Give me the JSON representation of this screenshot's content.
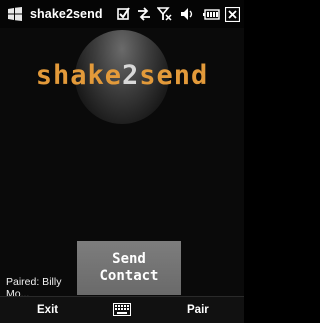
{
  "titlebar": {
    "title": "shake2send",
    "icons": [
      "windows-start-icon",
      "tasks-check-icon",
      "data-sync-icon",
      "no-signal-icon",
      "volume-icon",
      "battery-icon",
      "close-icon"
    ]
  },
  "logo": {
    "part1": "shake",
    "part2": "2",
    "part3": "send"
  },
  "paired": {
    "label": "Paired: Billy Mo..."
  },
  "send_button": {
    "line1": "Send",
    "line2": "Contact"
  },
  "softkeys": {
    "left": "Exit",
    "right": "Pair",
    "center_icon": "keyboard-icon"
  },
  "colors": {
    "logo_orange": "#e39a3a",
    "logo_gray": "#d9d9d9",
    "button_gray": "#747474"
  }
}
